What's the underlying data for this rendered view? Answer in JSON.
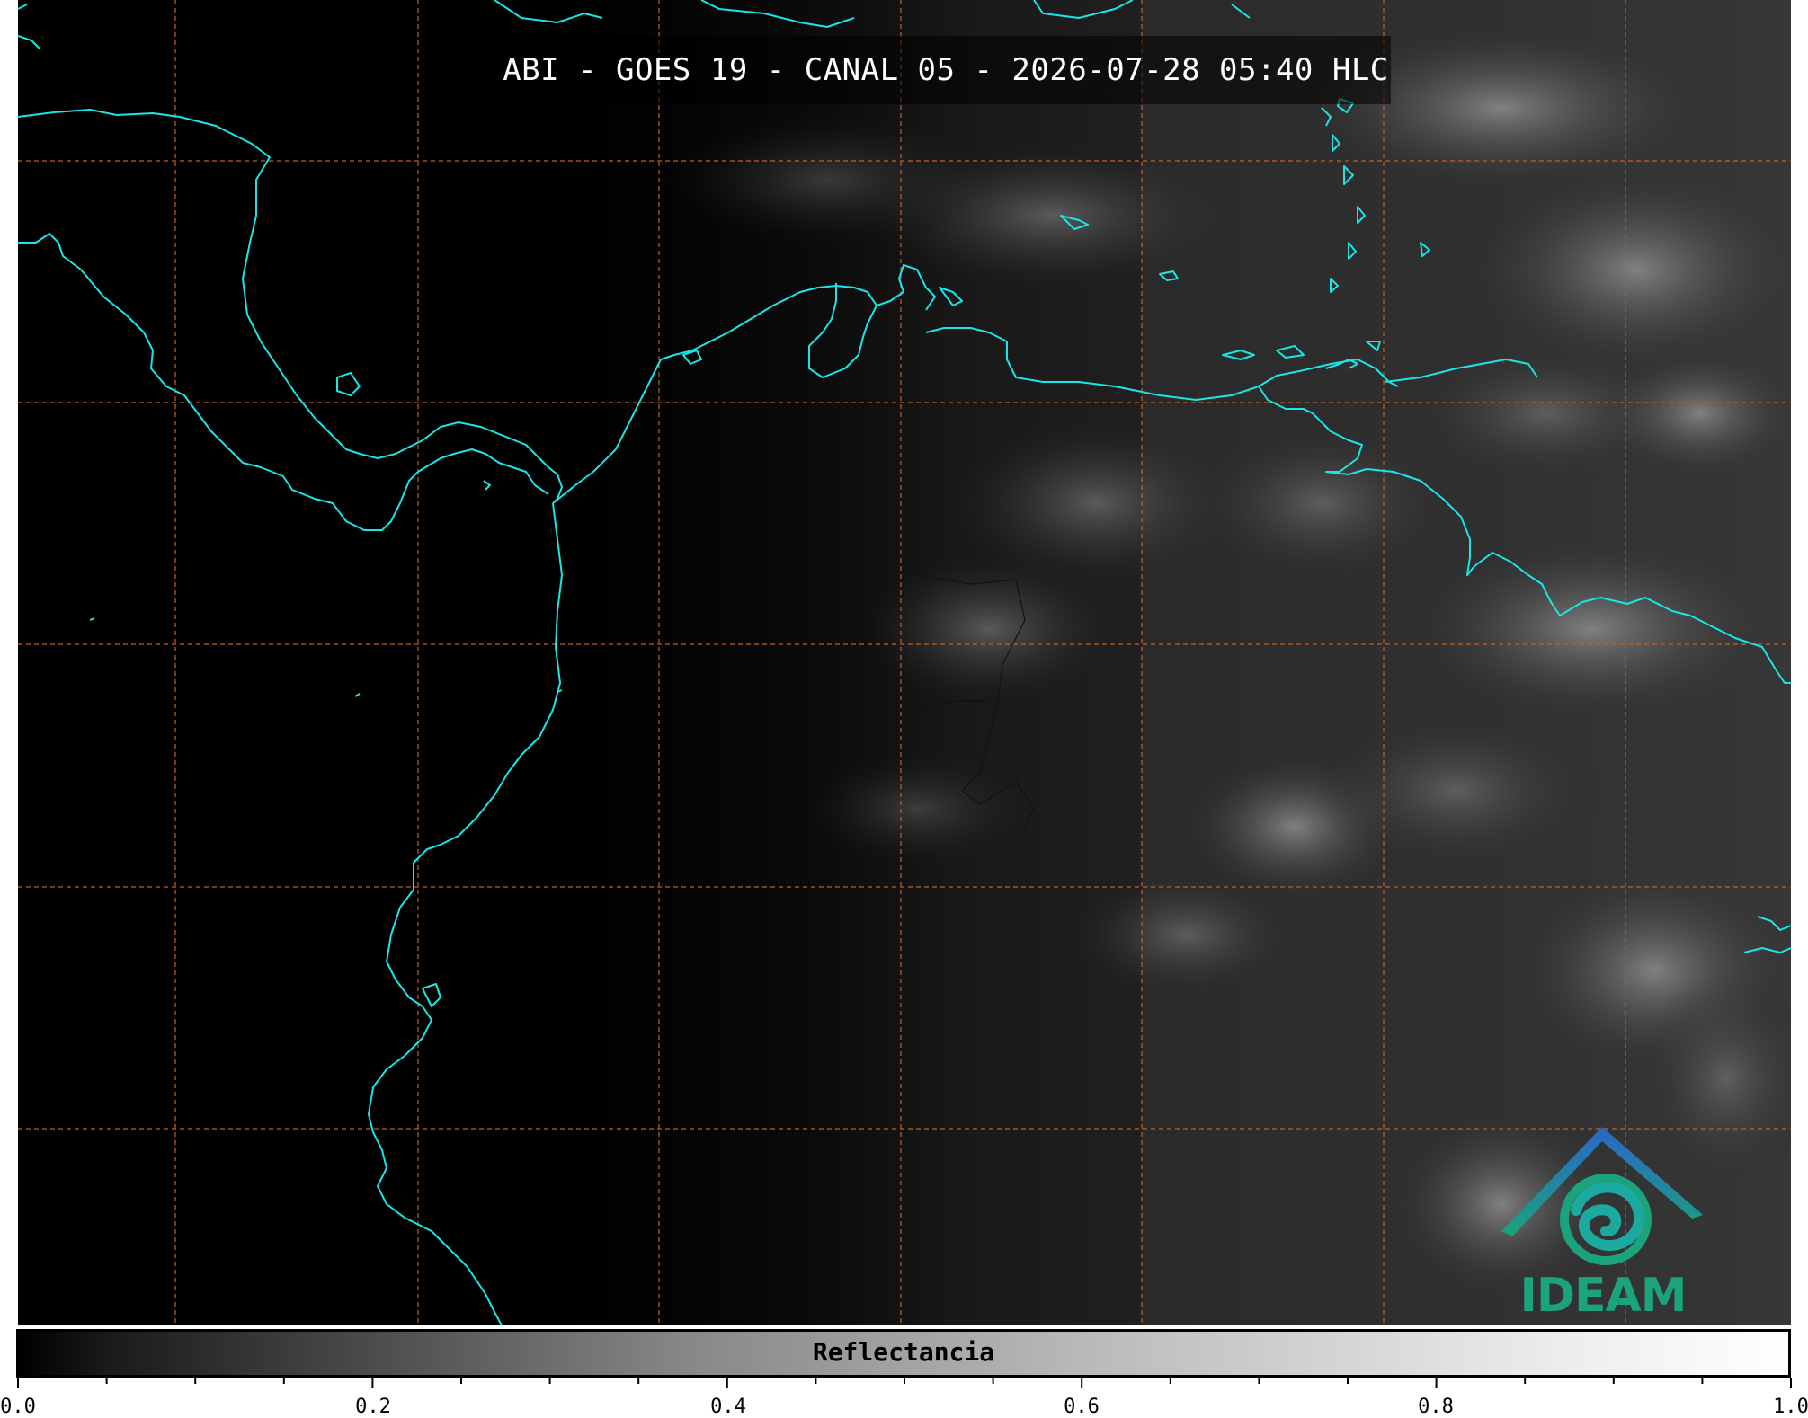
{
  "title": "ABI - GOES 19 - CANAL 05 - 2026-07-28 05:40 HLC",
  "logo": {
    "text": "IDEAM",
    "icon": "ideam-logo-icon"
  },
  "colorbar": {
    "label": "Reflectancia",
    "ticks": [
      "0.0",
      "0.2",
      "0.4",
      "0.6",
      "0.8",
      "1.0"
    ],
    "range": [
      0.0,
      1.0
    ],
    "colormap": "grayscale"
  },
  "colors": {
    "coastline": "#19e6e6",
    "gridline": "#c0602a",
    "background": "#000000"
  }
}
